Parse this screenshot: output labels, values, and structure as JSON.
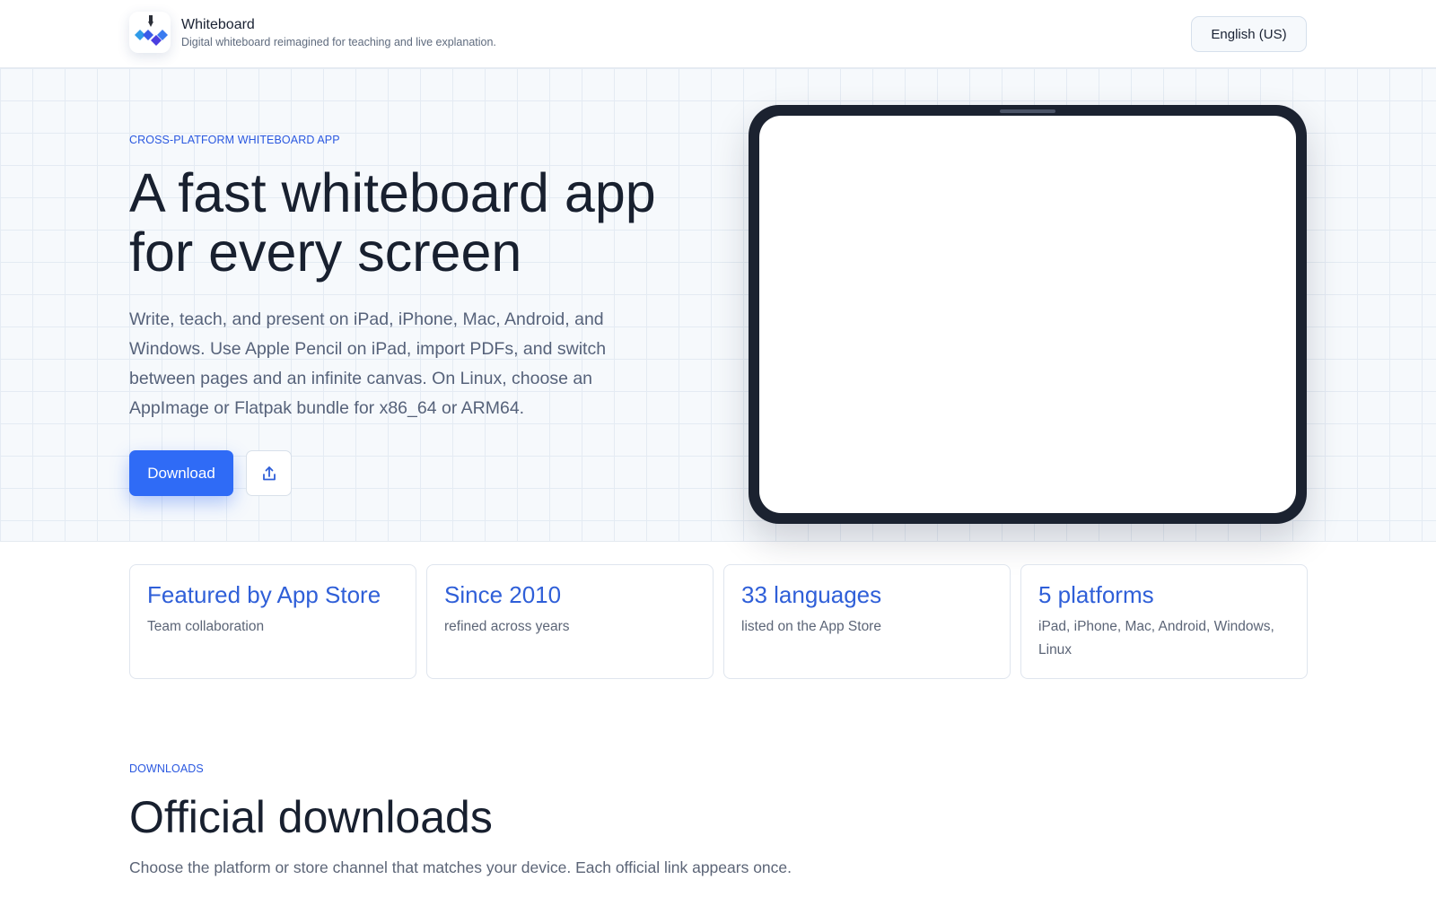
{
  "header": {
    "app_name": "Whiteboard",
    "tagline": "Digital whiteboard reimagined for teaching and live explanation.",
    "language_button": "English (US)",
    "logo_icon": "whiteboard-pen-logo"
  },
  "hero": {
    "eyebrow": "CROSS-PLATFORM WHITEBOARD APP",
    "title_line1": "A fast whiteboard app",
    "title_line2": "for every screen",
    "description": "Write, teach, and present on iPad, iPhone, Mac, Android, and Windows. Use Apple Pencil on iPad, import PDFs, and switch between pages and an infinite canvas. On Linux, choose an AppImage or Flatpak bundle for x86_64 or ARM64.",
    "download_label": "Download",
    "share_icon": "share-icon",
    "accent_color": "#2f6bf6"
  },
  "stats": [
    {
      "title": "Featured by App Store",
      "subtitle": "Team collaboration"
    },
    {
      "title": "Since 2010",
      "subtitle": "refined across years"
    },
    {
      "title": "33 languages",
      "subtitle": "listed on the App Store"
    },
    {
      "title": "5 platforms",
      "subtitle": "iPad, iPhone, Mac, Android, Windows, Linux"
    }
  ],
  "downloads": {
    "eyebrow": "DOWNLOADS",
    "title": "Official downloads",
    "description": "Choose the platform or store channel that matches your device. Each official link appears once."
  }
}
